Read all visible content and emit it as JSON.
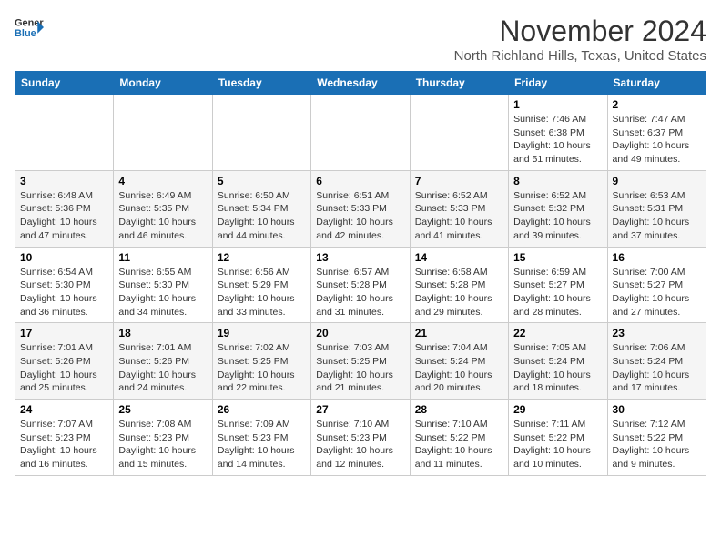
{
  "header": {
    "logo": {
      "line1": "General",
      "line2": "Blue"
    },
    "month": "November 2024",
    "location": "North Richland Hills, Texas, United States"
  },
  "weekdays": [
    "Sunday",
    "Monday",
    "Tuesday",
    "Wednesday",
    "Thursday",
    "Friday",
    "Saturday"
  ],
  "weeks": [
    [
      {
        "day": "",
        "info": ""
      },
      {
        "day": "",
        "info": ""
      },
      {
        "day": "",
        "info": ""
      },
      {
        "day": "",
        "info": ""
      },
      {
        "day": "",
        "info": ""
      },
      {
        "day": "1",
        "info": "Sunrise: 7:46 AM\nSunset: 6:38 PM\nDaylight: 10 hours\nand 51 minutes."
      },
      {
        "day": "2",
        "info": "Sunrise: 7:47 AM\nSunset: 6:37 PM\nDaylight: 10 hours\nand 49 minutes."
      }
    ],
    [
      {
        "day": "3",
        "info": "Sunrise: 6:48 AM\nSunset: 5:36 PM\nDaylight: 10 hours\nand 47 minutes."
      },
      {
        "day": "4",
        "info": "Sunrise: 6:49 AM\nSunset: 5:35 PM\nDaylight: 10 hours\nand 46 minutes."
      },
      {
        "day": "5",
        "info": "Sunrise: 6:50 AM\nSunset: 5:34 PM\nDaylight: 10 hours\nand 44 minutes."
      },
      {
        "day": "6",
        "info": "Sunrise: 6:51 AM\nSunset: 5:33 PM\nDaylight: 10 hours\nand 42 minutes."
      },
      {
        "day": "7",
        "info": "Sunrise: 6:52 AM\nSunset: 5:33 PM\nDaylight: 10 hours\nand 41 minutes."
      },
      {
        "day": "8",
        "info": "Sunrise: 6:52 AM\nSunset: 5:32 PM\nDaylight: 10 hours\nand 39 minutes."
      },
      {
        "day": "9",
        "info": "Sunrise: 6:53 AM\nSunset: 5:31 PM\nDaylight: 10 hours\nand 37 minutes."
      }
    ],
    [
      {
        "day": "10",
        "info": "Sunrise: 6:54 AM\nSunset: 5:30 PM\nDaylight: 10 hours\nand 36 minutes."
      },
      {
        "day": "11",
        "info": "Sunrise: 6:55 AM\nSunset: 5:30 PM\nDaylight: 10 hours\nand 34 minutes."
      },
      {
        "day": "12",
        "info": "Sunrise: 6:56 AM\nSunset: 5:29 PM\nDaylight: 10 hours\nand 33 minutes."
      },
      {
        "day": "13",
        "info": "Sunrise: 6:57 AM\nSunset: 5:28 PM\nDaylight: 10 hours\nand 31 minutes."
      },
      {
        "day": "14",
        "info": "Sunrise: 6:58 AM\nSunset: 5:28 PM\nDaylight: 10 hours\nand 29 minutes."
      },
      {
        "day": "15",
        "info": "Sunrise: 6:59 AM\nSunset: 5:27 PM\nDaylight: 10 hours\nand 28 minutes."
      },
      {
        "day": "16",
        "info": "Sunrise: 7:00 AM\nSunset: 5:27 PM\nDaylight: 10 hours\nand 27 minutes."
      }
    ],
    [
      {
        "day": "17",
        "info": "Sunrise: 7:01 AM\nSunset: 5:26 PM\nDaylight: 10 hours\nand 25 minutes."
      },
      {
        "day": "18",
        "info": "Sunrise: 7:01 AM\nSunset: 5:26 PM\nDaylight: 10 hours\nand 24 minutes."
      },
      {
        "day": "19",
        "info": "Sunrise: 7:02 AM\nSunset: 5:25 PM\nDaylight: 10 hours\nand 22 minutes."
      },
      {
        "day": "20",
        "info": "Sunrise: 7:03 AM\nSunset: 5:25 PM\nDaylight: 10 hours\nand 21 minutes."
      },
      {
        "day": "21",
        "info": "Sunrise: 7:04 AM\nSunset: 5:24 PM\nDaylight: 10 hours\nand 20 minutes."
      },
      {
        "day": "22",
        "info": "Sunrise: 7:05 AM\nSunset: 5:24 PM\nDaylight: 10 hours\nand 18 minutes."
      },
      {
        "day": "23",
        "info": "Sunrise: 7:06 AM\nSunset: 5:24 PM\nDaylight: 10 hours\nand 17 minutes."
      }
    ],
    [
      {
        "day": "24",
        "info": "Sunrise: 7:07 AM\nSunset: 5:23 PM\nDaylight: 10 hours\nand 16 minutes."
      },
      {
        "day": "25",
        "info": "Sunrise: 7:08 AM\nSunset: 5:23 PM\nDaylight: 10 hours\nand 15 minutes."
      },
      {
        "day": "26",
        "info": "Sunrise: 7:09 AM\nSunset: 5:23 PM\nDaylight: 10 hours\nand 14 minutes."
      },
      {
        "day": "27",
        "info": "Sunrise: 7:10 AM\nSunset: 5:23 PM\nDaylight: 10 hours\nand 12 minutes."
      },
      {
        "day": "28",
        "info": "Sunrise: 7:10 AM\nSunset: 5:22 PM\nDaylight: 10 hours\nand 11 minutes."
      },
      {
        "day": "29",
        "info": "Sunrise: 7:11 AM\nSunset: 5:22 PM\nDaylight: 10 hours\nand 10 minutes."
      },
      {
        "day": "30",
        "info": "Sunrise: 7:12 AM\nSunset: 5:22 PM\nDaylight: 10 hours\nand 9 minutes."
      }
    ]
  ]
}
